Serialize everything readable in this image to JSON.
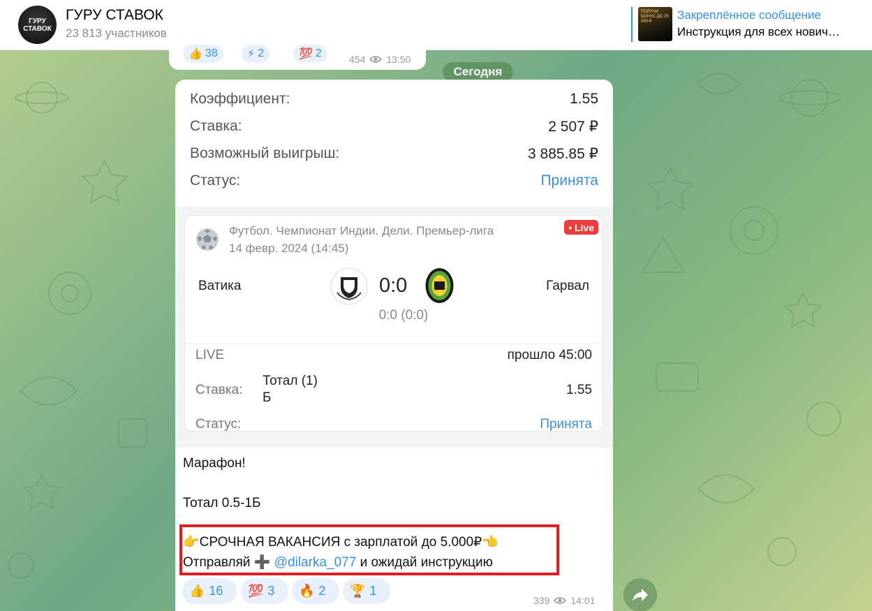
{
  "header": {
    "title": "ГУРУ СТАВОК",
    "subtitle": "23 813 участников",
    "avatar_text": "ГУРУ СТАВОК",
    "pinned_label": "Закреплённое сообщение",
    "pinned_text": "Инструкция для всех нович…",
    "pinned_thumb_text": "ПОЛУЧИ БОНУС ДО 25 000 ₽"
  },
  "prev_message": {
    "reactions": [
      {
        "emoji": "👍",
        "count": "38"
      },
      {
        "emoji": "⚡",
        "count": "2"
      },
      {
        "emoji": "💯",
        "count": "2"
      }
    ],
    "views": "454",
    "time": "13:50"
  },
  "date_separator": "Сегодня",
  "bet_summary": {
    "rows": [
      {
        "label": "Коэффициент:",
        "value": "1.55"
      },
      {
        "label": "Ставка:",
        "value": "2 507 ₽"
      },
      {
        "label": "Возможный выигрыш:",
        "value": "3 885.85 ₽"
      },
      {
        "label": "Статус:",
        "value": "Принята"
      }
    ]
  },
  "match": {
    "league": "Футбол. Чемпионат Индии. Дели. Премьер-лига",
    "date": "14 февр. 2024 (14:45)",
    "live_badge": "• Live",
    "team_home": "Ватика",
    "team_away": "Гарвал",
    "score": "0:0",
    "sub_score": "0:0 (0:0)",
    "live_label": "LIVE",
    "elapsed": "прошло 45:00",
    "stake_label": "Ставка:",
    "stake_value": "Тотал (1) Б",
    "stake_coef": "1.55",
    "status_label": "Статус:",
    "status_value": "Принята"
  },
  "message": {
    "line1": "Марафон!",
    "line2": "Тотал 0.5-1Б",
    "line3": "👉СРОЧНАЯ ВАКАНСИЯ с зарплатой до 5.000₽👈",
    "line4_prefix": "Отправляй ➕ ",
    "line4_mention": "@dilarka_077",
    "line4_suffix": " и ожидай инструкцию"
  },
  "reactions": [
    {
      "emoji": "👍",
      "count": "16"
    },
    {
      "emoji": "💯",
      "count": "3"
    },
    {
      "emoji": "🔥",
      "count": "2"
    },
    {
      "emoji": "🏆",
      "count": "1"
    }
  ],
  "meta": {
    "views": "339",
    "time": "14:01"
  },
  "colors": {
    "accent": "#3390ec",
    "live": "#ee3b3b",
    "highlight": "#e02020"
  }
}
